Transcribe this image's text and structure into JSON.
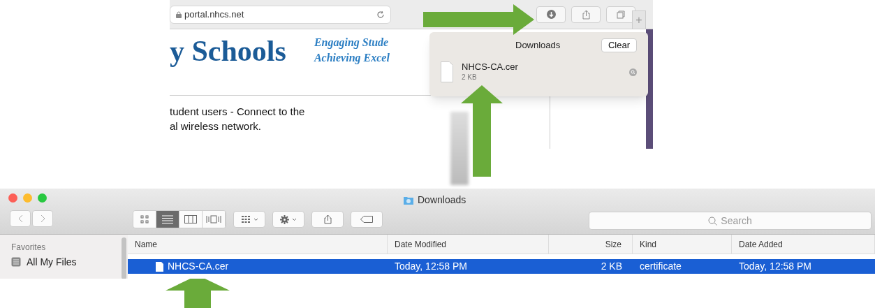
{
  "browser": {
    "address": "portal.nhcs.net",
    "new_tab": "+",
    "page": {
      "heading": "y Schools",
      "tagline_lines": [
        "Engaging Stude",
        "Achieving Excel"
      ],
      "text_lines": [
        "tudent users - Connect to the",
        "al wireless network."
      ]
    },
    "downloads_popover": {
      "title": "Downloads",
      "clear_button": "Clear",
      "items": [
        {
          "name": "NHCS-CA.cer",
          "size": "2 KB"
        }
      ]
    }
  },
  "finder": {
    "window_title": "Downloads",
    "view_modes": [
      {
        "kind": "icons",
        "selected": false
      },
      {
        "kind": "list",
        "selected": true
      },
      {
        "kind": "columns",
        "selected": false
      },
      {
        "kind": "cover_flow",
        "selected": false
      }
    ],
    "search": {
      "placeholder": "Search"
    },
    "sidebar": {
      "heading": "Favorites",
      "items": [
        {
          "label": "All My Files"
        }
      ]
    },
    "table": {
      "columns": [
        "Name",
        "Date Modified",
        "Size",
        "Kind",
        "Date Added"
      ],
      "rows": [
        {
          "cells": [
            "NHCS-CA.cer",
            "Today, 12:58 PM",
            "2 KB",
            "certificate",
            "Today, 12:58 PM"
          ],
          "selected": true
        }
      ]
    }
  }
}
